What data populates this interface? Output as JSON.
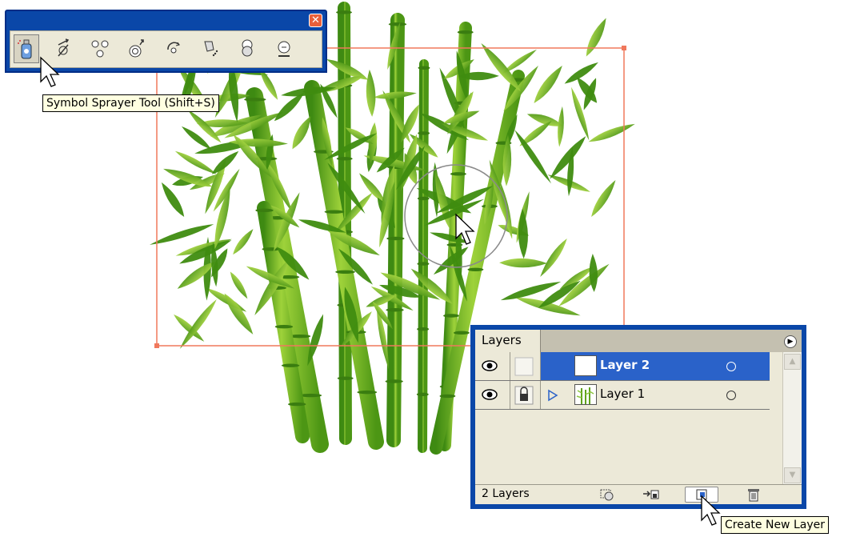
{
  "toolbar": {
    "close_glyph": "✕",
    "tools": [
      {
        "name": "symbol-sprayer-tool-icon",
        "selected": true
      },
      {
        "name": "symbol-shifter-tool-icon",
        "selected": false
      },
      {
        "name": "symbol-scruncher-tool-icon",
        "selected": false
      },
      {
        "name": "symbol-sizer-tool-icon",
        "selected": false
      },
      {
        "name": "symbol-spinner-tool-icon",
        "selected": false
      },
      {
        "name": "symbol-stainer-tool-icon",
        "selected": false
      },
      {
        "name": "symbol-screener-tool-icon",
        "selected": false
      },
      {
        "name": "symbol-styler-tool-icon",
        "selected": false
      }
    ],
    "tooltip": "Symbol Sprayer Tool (Shift+S)"
  },
  "layers_panel": {
    "tab_label": "Layers",
    "menu_glyph": "▶",
    "layers": [
      {
        "name": "Layer 2",
        "selected": true,
        "locked": false,
        "visible": true,
        "expandable": false
      },
      {
        "name": "Layer 1",
        "selected": false,
        "locked": true,
        "visible": true,
        "expandable": true
      }
    ],
    "footer_count": "2 Layers",
    "footer_buttons": [
      "make-clipping-mask-icon",
      "create-sublayer-icon",
      "create-new-layer-icon",
      "delete-layer-icon"
    ],
    "tooltip": "Create New Layer"
  },
  "colors": {
    "title_blue": "#0a47a8",
    "selection_blue": "#2a62c9",
    "bounding_box": "#f0785c",
    "bamboo_green": "#5fa21c",
    "panel_bg": "#ece9d8"
  }
}
